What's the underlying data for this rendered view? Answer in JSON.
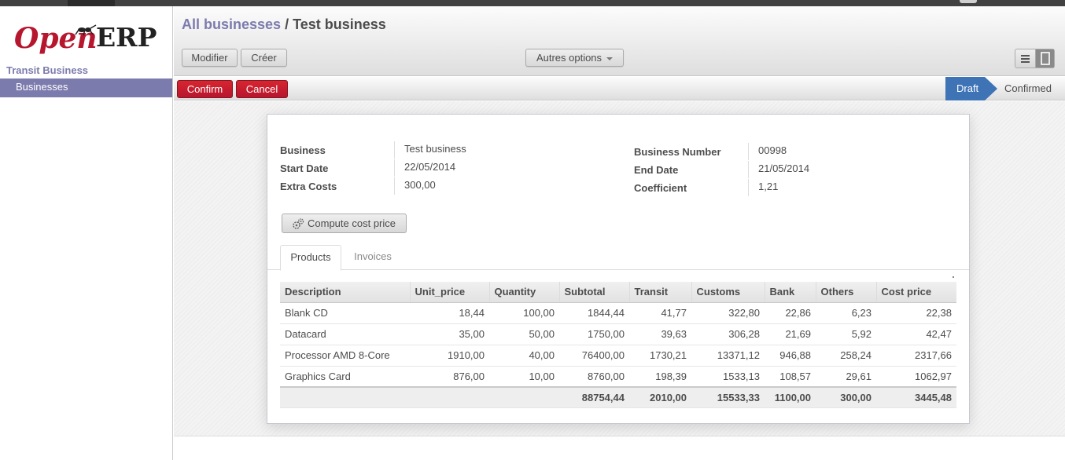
{
  "app": {
    "logo_open": "Open",
    "logo_erp": "ERP"
  },
  "sidebar": {
    "section": "Transit Business",
    "items": [
      {
        "label": "Businesses",
        "active": true
      }
    ]
  },
  "breadcrumb": {
    "parent": "All businesses",
    "separator": " / ",
    "current": "Test business"
  },
  "toolbar": {
    "modifier": "Modifier",
    "creer": "Créer",
    "autres_options": "Autres options"
  },
  "statusbar": {
    "confirm": "Confirm",
    "cancel": "Cancel",
    "stages": [
      {
        "label": "Draft",
        "active": true
      },
      {
        "label": "Confirmed",
        "active": false
      }
    ]
  },
  "form": {
    "business_label": "Business",
    "business_value": "Test business",
    "start_date_label": "Start Date",
    "start_date_value": "22/05/2014",
    "extra_costs_label": "Extra Costs",
    "extra_costs_value": "300,00",
    "business_number_label": "Business Number",
    "business_number_value": "00998",
    "end_date_label": "End Date",
    "end_date_value": "21/05/2014",
    "coefficient_label": "Coefficient",
    "coefficient_value": "1,21",
    "compute_button": "Compute cost price"
  },
  "tabs": {
    "products": "Products",
    "invoices": "Invoices"
  },
  "lines": {
    "columns": [
      "Description",
      "Unit_price",
      "Quantity",
      "Subtotal",
      "Transit",
      "Customs",
      "Bank",
      "Others",
      "Cost price"
    ],
    "rows": [
      [
        "Blank CD",
        "18,44",
        "100,00",
        "1844,44",
        "41,77",
        "322,80",
        "22,86",
        "6,23",
        "22,38"
      ],
      [
        "Datacard",
        "35,00",
        "50,00",
        "1750,00",
        "39,63",
        "306,28",
        "21,69",
        "5,92",
        "42,47"
      ],
      [
        "Processor AMD 8-Core",
        "1910,00",
        "40,00",
        "76400,00",
        "1730,21",
        "13371,12",
        "946,88",
        "258,24",
        "2317,66"
      ],
      [
        "Graphics Card",
        "876,00",
        "10,00",
        "8760,00",
        "198,39",
        "1533,13",
        "108,57",
        "29,61",
        "1062,97"
      ]
    ],
    "totals": [
      "",
      "",
      "",
      "88754,44",
      "2010,00",
      "15533,33",
      "1100,00",
      "300,00",
      "3445,48"
    ]
  },
  "colors": {
    "accent": "#7c7bad",
    "danger": "#b6162e",
    "stage_active": "#3e73b6"
  },
  "icons": {
    "list_view": "list-view-icon",
    "form_view": "form-view-icon",
    "compute": "gears-icon"
  }
}
